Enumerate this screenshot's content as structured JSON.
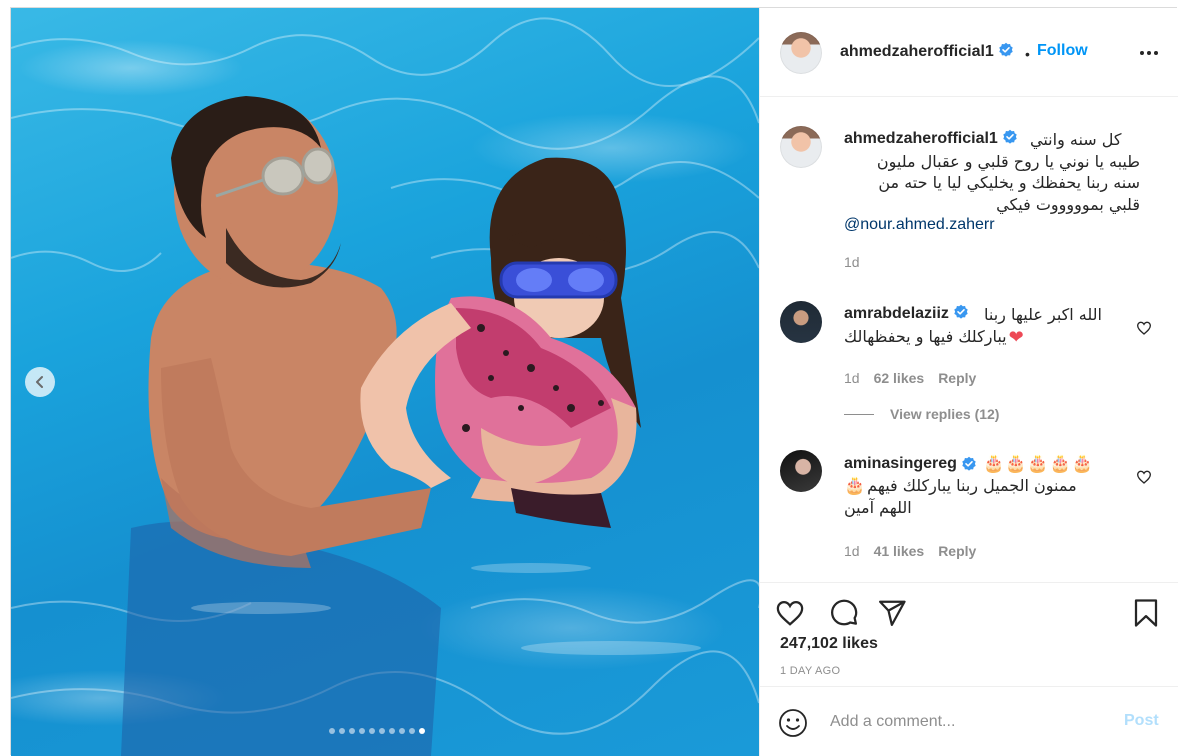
{
  "post": {
    "owner": "ahmedzaherofficial1",
    "follow_label": "Follow",
    "separator": "•"
  },
  "caption": {
    "username": "ahmedzaherofficial1",
    "text_line1": "كل سنه وانتي",
    "text_line2": "طيبه يا نوني يا روح قلبي و عقبال مليون",
    "text_line3": "سنه ربنا يحفظك و يخليكي ليا يا حته من",
    "text_line4": "قلبي بموووووت فيكي",
    "mention": "@nour.ahmed.zaherr",
    "time": "1d"
  },
  "comments": [
    {
      "username": "amrabdelaziiz",
      "line1": "الله اكبر عليها ربنا",
      "line2": "يباركلك فيها و يحفظهالك",
      "emoji": "❤",
      "time": "1d",
      "likes": "62 likes",
      "reply_label": "Reply"
    },
    {
      "username": "aminasingereg",
      "emoji_row": "🎂🎂🎂🎂🎂",
      "line1": "ممنون الجميل ربنا يباركلك فيهم",
      "line1_emoji": "🎂",
      "line2": "اللهم آمين",
      "time": "1d",
      "likes": "41 likes",
      "reply_label": "Reply"
    }
  ],
  "view_replies": "View replies (12)",
  "likes_count": "247,102 likes",
  "posted": "1 DAY AGO",
  "add_comment": {
    "placeholder": "Add a comment...",
    "post_label": "Post"
  },
  "carousel": {
    "total": 10,
    "active_index": 9
  },
  "colors": {
    "link_blue": "#0095f6",
    "mention_blue": "#00376b",
    "post_disabled": "#b2dffc",
    "verified_blue": "#3897f0",
    "heart_red": "#ed4956",
    "muted": "#8e8e8e"
  },
  "icons": [
    "chevron-left-icon",
    "verified-icon",
    "more-icon",
    "heart-outline-icon",
    "comment-icon",
    "share-icon",
    "bookmark-icon",
    "emoji-icon"
  ]
}
